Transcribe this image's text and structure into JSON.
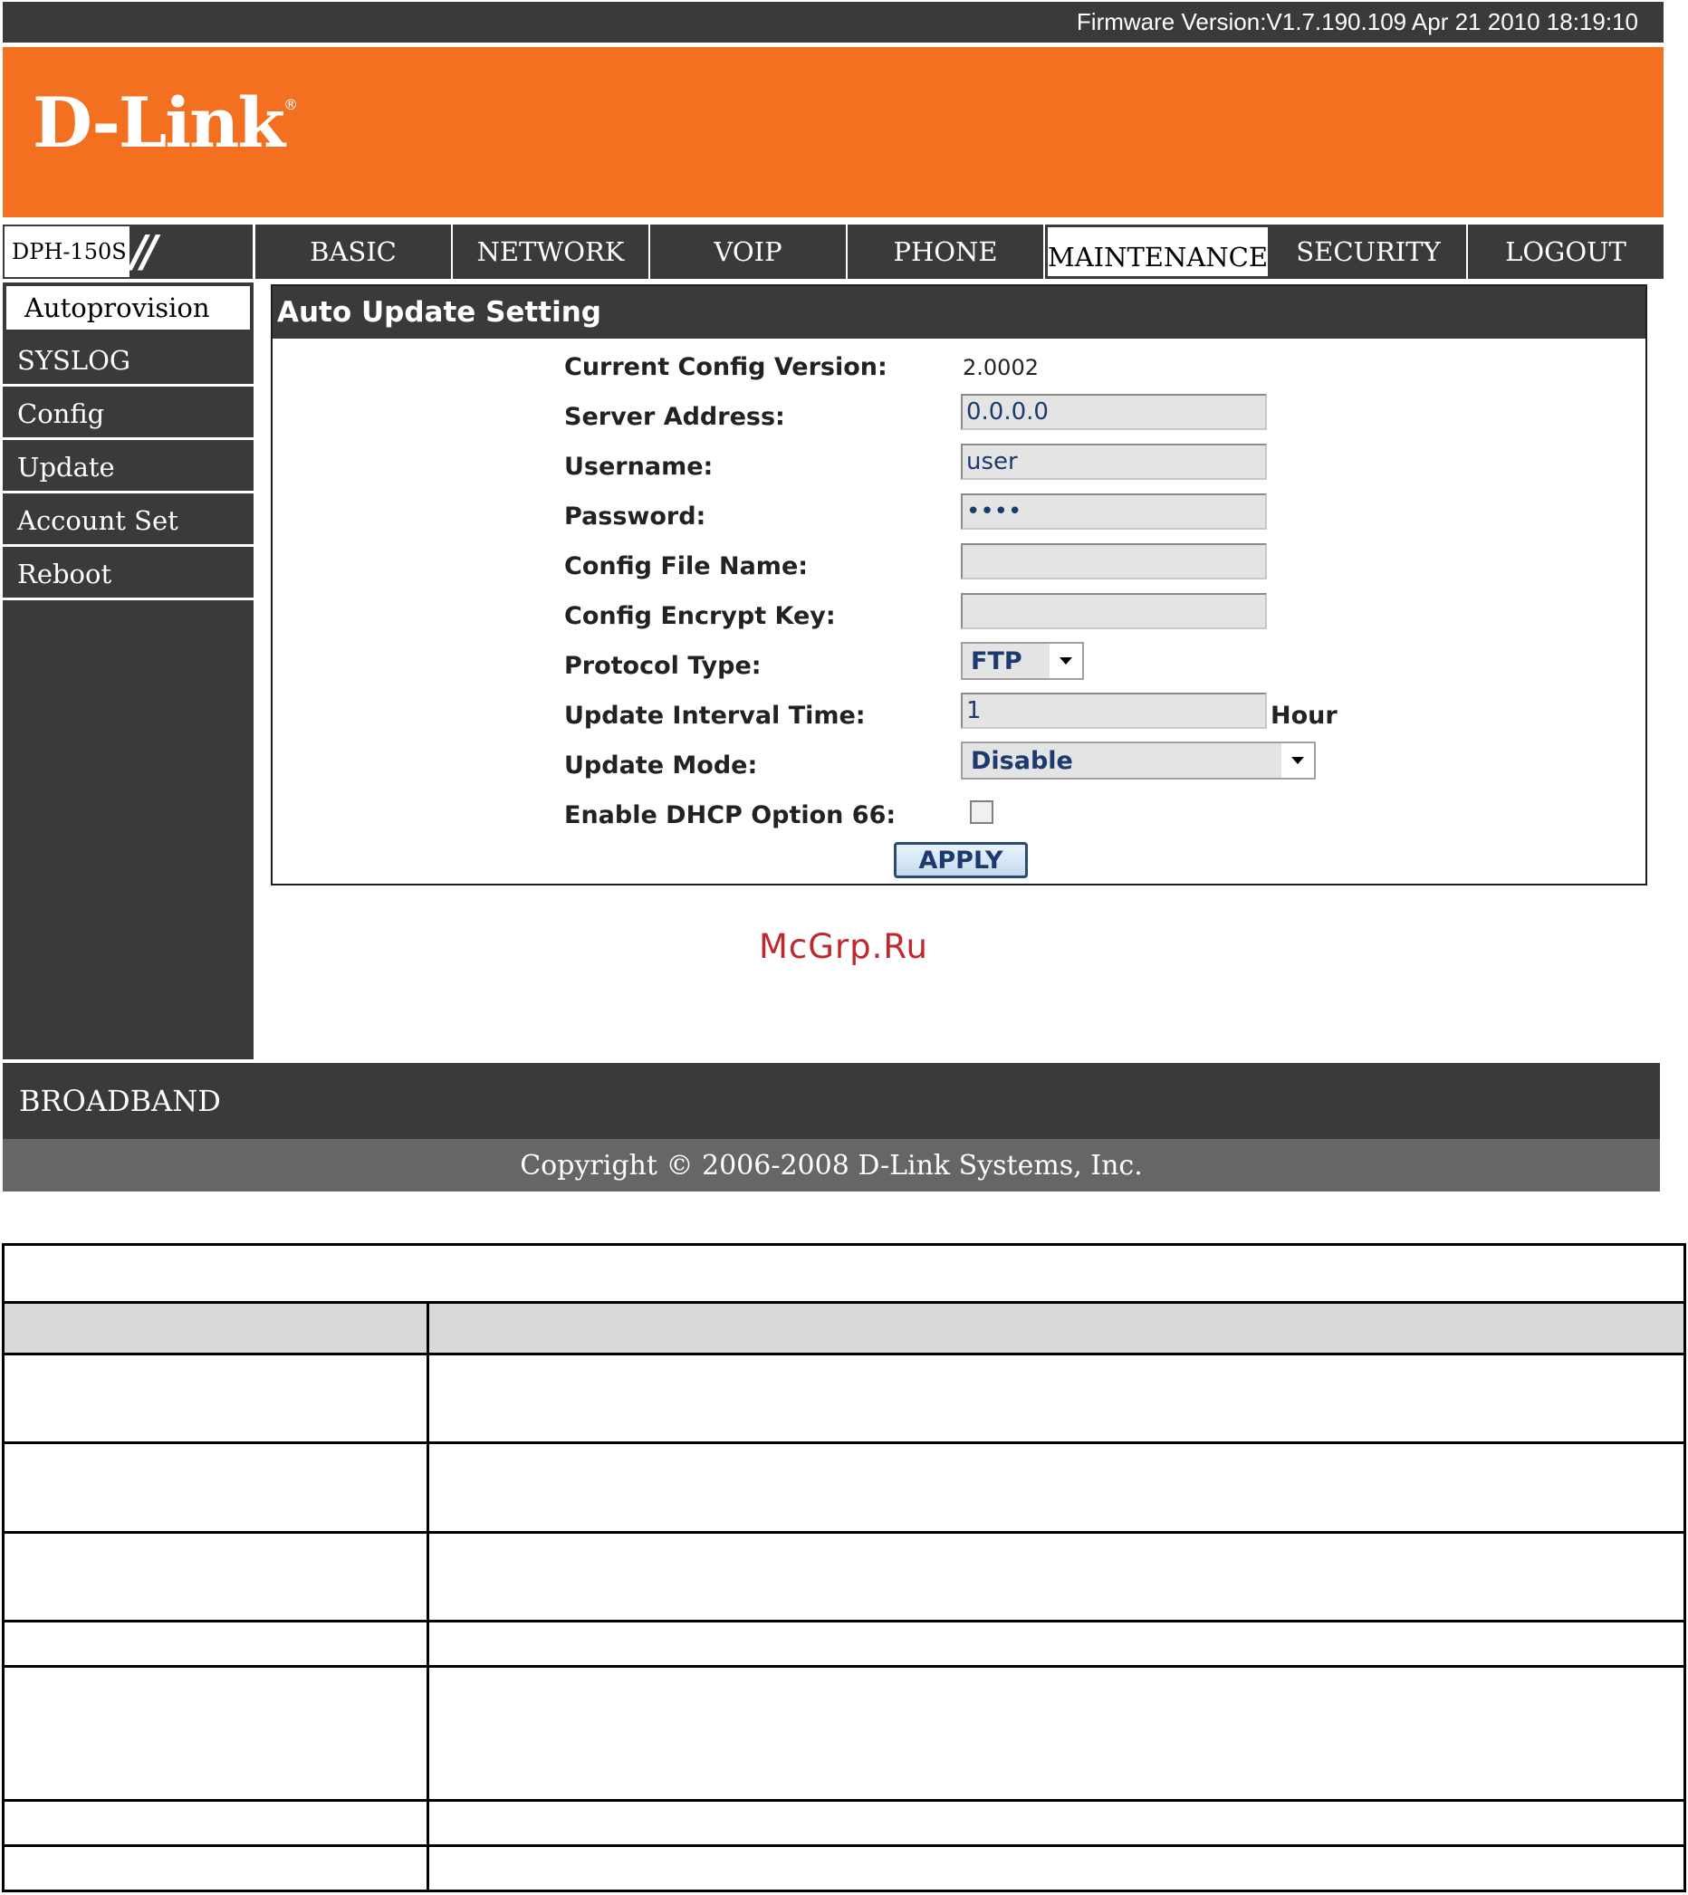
{
  "firmware": "Firmware Version:V1.7.190.109 Apr 21 2010 18:19:10",
  "brand": {
    "logo_text": "D-Link",
    "registered": "®",
    "accent_color": "#f37021",
    "dark_color": "#3a3a3a"
  },
  "model": {
    "name": "DPH-150S",
    "decoration": "//"
  },
  "nav": {
    "tabs": [
      {
        "label": "BASIC"
      },
      {
        "label": "NETWORK"
      },
      {
        "label": "VOIP"
      },
      {
        "label": "PHONE"
      },
      {
        "label": "MAINTENANCE",
        "active": true
      },
      {
        "label": "SECURITY"
      },
      {
        "label": "LOGOUT"
      }
    ]
  },
  "sidebar": {
    "items": [
      {
        "label": "Autoprovision",
        "active": true
      },
      {
        "label": "SYSLOG"
      },
      {
        "label": "Config"
      },
      {
        "label": "Update"
      },
      {
        "label": "Account Set"
      },
      {
        "label": "Reboot"
      }
    ]
  },
  "panel": {
    "title": "Auto Update Setting",
    "current_config_version": {
      "label": "Current Config Version:",
      "value": "2.0002"
    },
    "server_address": {
      "label": "Server Address:",
      "value": "0.0.0.0"
    },
    "username": {
      "label": "Username:",
      "value": "user"
    },
    "password": {
      "label": "Password:",
      "value": "user"
    },
    "config_file_name": {
      "label": "Config File Name:",
      "value": ""
    },
    "config_encrypt_key": {
      "label": "Config Encrypt Key:",
      "value": ""
    },
    "protocol_type": {
      "label": "Protocol Type:",
      "value": "FTP"
    },
    "update_interval": {
      "label": "Update Interval Time:",
      "value": "1",
      "unit": "Hour"
    },
    "update_mode": {
      "label": "Update Mode:",
      "value": "Disable"
    },
    "dhcp66": {
      "label": "Enable DHCP Option 66:",
      "checked": false
    },
    "apply_label": "APPLY"
  },
  "watermark": "McGrp.Ru",
  "footer": {
    "broadband": "BROADBAND",
    "copyright": "Copyright © 2006-2008 D-Link Systems, Inc."
  }
}
